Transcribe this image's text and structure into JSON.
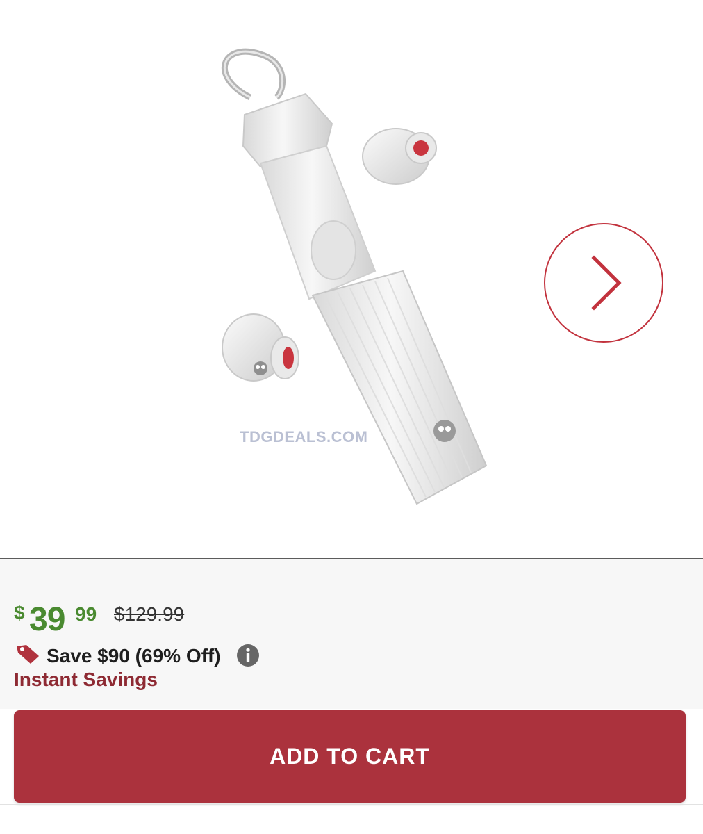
{
  "carousel": {
    "next_icon": "chevron-right-icon",
    "watermark": "TDGDEALS.COM"
  },
  "price": {
    "currency": "$",
    "whole": "39",
    "cents": "99",
    "original": "$129.99",
    "sale_color": "#4a8a30"
  },
  "savings": {
    "tag_icon": "price-tag-icon",
    "text": "Save $90 (69% Off)",
    "info_icon": "info-icon",
    "label": "Instant Savings",
    "label_color": "#8e2a33"
  },
  "cart": {
    "button_label": "ADD TO CART",
    "button_color": "#ab323d"
  }
}
